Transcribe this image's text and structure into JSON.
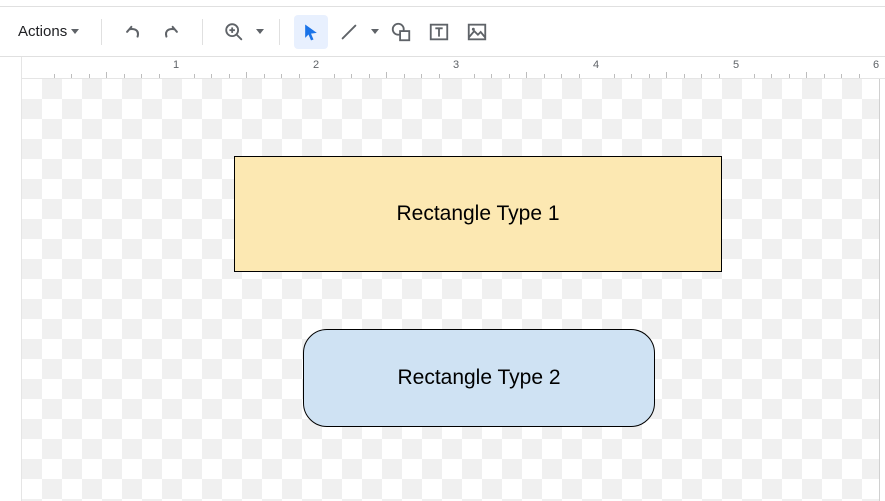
{
  "toolbar": {
    "actions_label": "Actions"
  },
  "ruler": {
    "marks": [
      "1",
      "2",
      "3",
      "4",
      "5",
      "6"
    ]
  },
  "shapes": {
    "rect1_label": "Rectangle Type 1",
    "rect2_label": "Rectangle Type 2"
  }
}
